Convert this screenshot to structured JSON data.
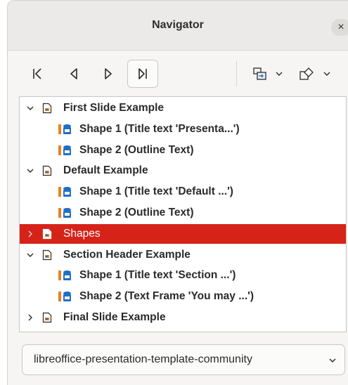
{
  "window": {
    "title": "Navigator",
    "close_symbol": "×"
  },
  "toolbar": {
    "buttons": [
      {
        "name": "first-slide",
        "icon": "first-icon"
      },
      {
        "name": "previous-slide",
        "icon": "previous-icon"
      },
      {
        "name": "next-slide",
        "icon": "next-icon"
      },
      {
        "name": "last-slide",
        "icon": "last-icon",
        "active": true
      },
      {
        "name": "drag-mode",
        "icon": "drag-mode-icon"
      },
      {
        "name": "shapes-filter",
        "icon": "shapes-icon"
      }
    ]
  },
  "tree": {
    "items": [
      {
        "label": "First Slide Example",
        "type": "slide",
        "expanded": true
      },
      {
        "label": "Shape 1 (Title text 'Presenta...')",
        "type": "shape"
      },
      {
        "label": "Shape 2 (Outline Text)",
        "type": "shape"
      },
      {
        "label": "Default Example",
        "type": "slide",
        "expanded": true
      },
      {
        "label": "Shape 1 (Title text 'Default ...')",
        "type": "shape"
      },
      {
        "label": "Shape 2 (Outline Text)",
        "type": "shape"
      },
      {
        "label": "Shapes",
        "type": "slide",
        "expanded": false,
        "selected": true
      },
      {
        "label": "Section Header Example",
        "type": "slide",
        "expanded": true
      },
      {
        "label": "Shape 1 (Title text 'Section ...')",
        "type": "shape"
      },
      {
        "label": "Shape 2 (Text Frame 'You may ...')",
        "type": "shape"
      },
      {
        "label": "Final Slide Example",
        "type": "slide",
        "expanded": false
      }
    ]
  },
  "document_select": {
    "value": "libreoffice-presentation-template-community"
  },
  "colors": {
    "selection": "#d6231a",
    "shape_orange": "#e8821e",
    "shape_blue": "#1f6fc6"
  }
}
